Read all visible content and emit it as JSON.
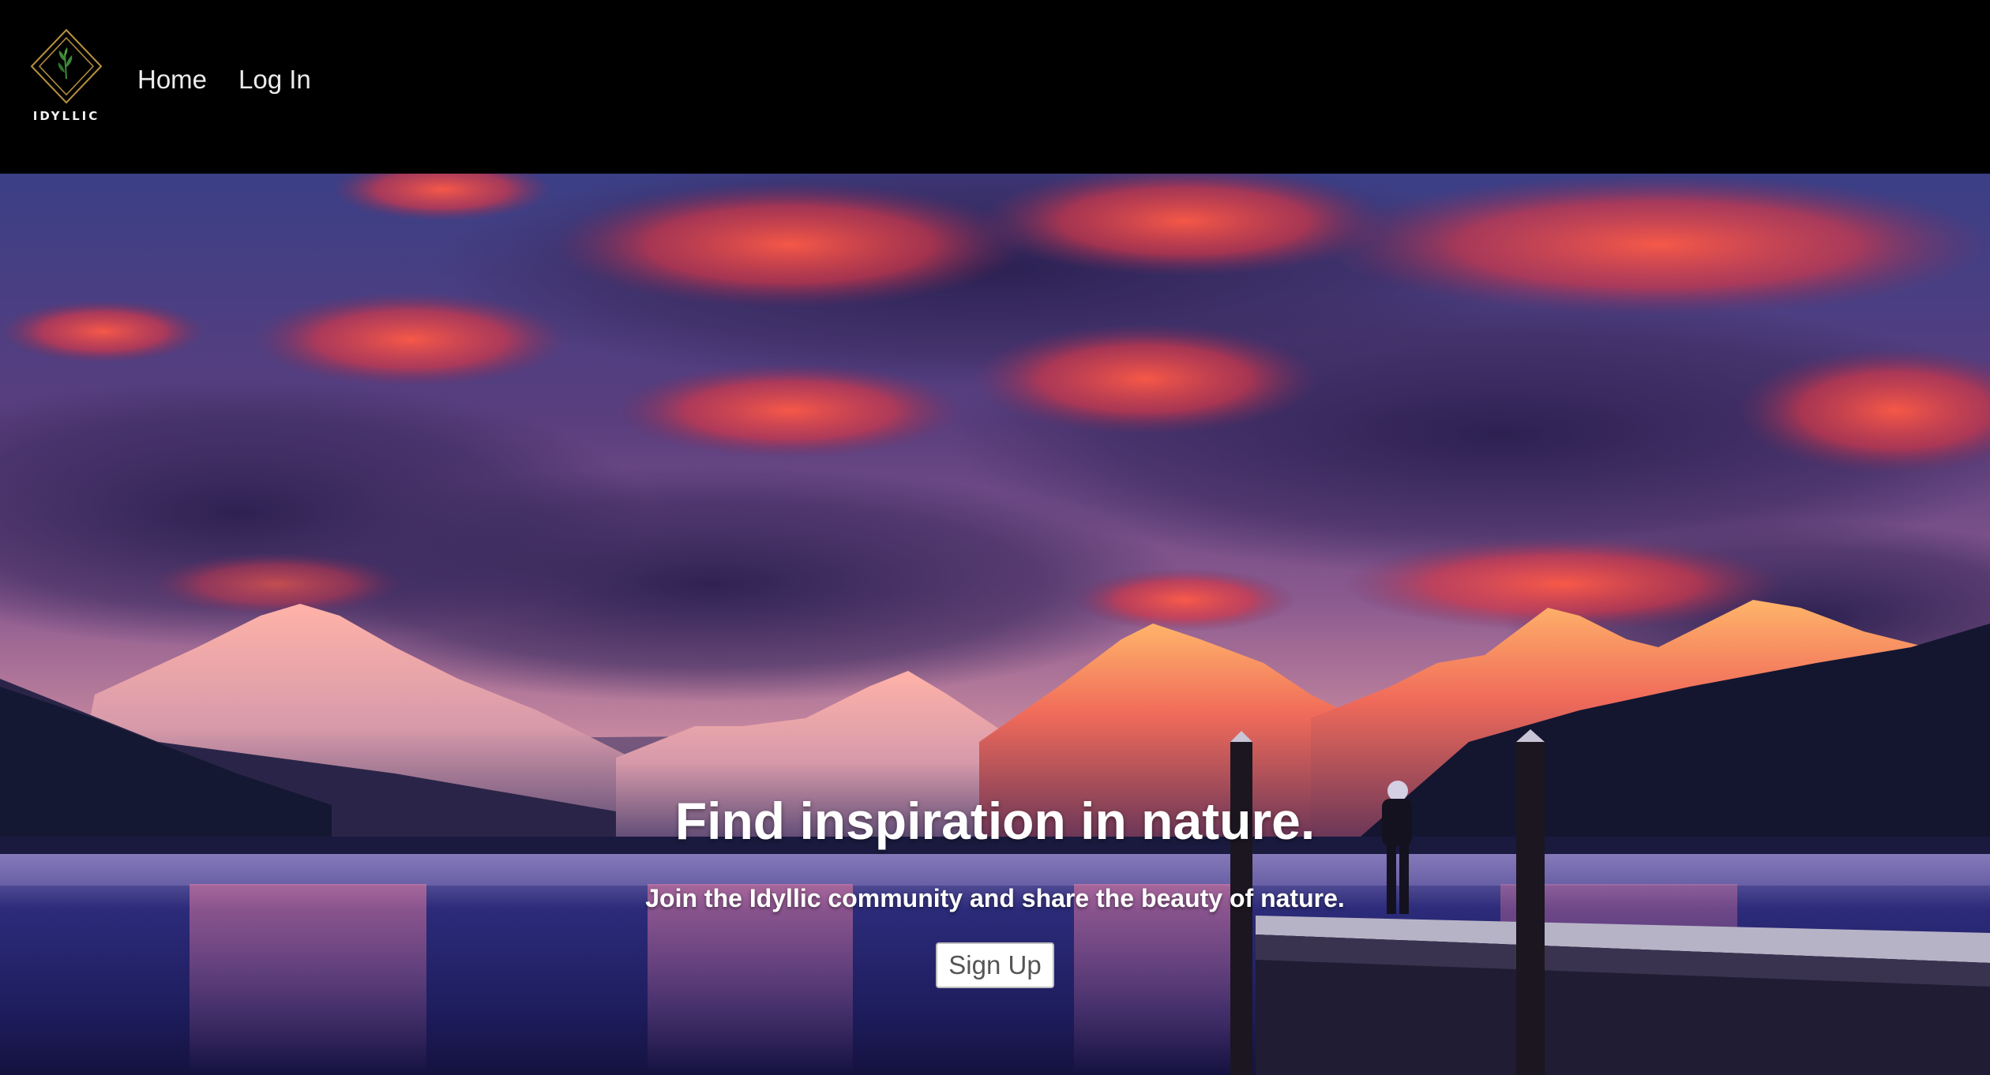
{
  "brand": {
    "logo_text": "IDYLLIC",
    "logo_icon": "diamond-leaf-icon"
  },
  "nav": {
    "items": [
      {
        "label": "Home"
      },
      {
        "label": "Log In"
      }
    ]
  },
  "hero": {
    "title": "Find inspiration in nature.",
    "subtitle": "Join the Idyllic community and share the beauty of nature.",
    "cta_label": "Sign Up",
    "background": "sunset-mountain-lake-photo"
  },
  "colors": {
    "nav_background": "#000000",
    "nav_text": "#ececec",
    "logo_gold": "#b8913f",
    "logo_leaf": "#3e8a3a",
    "hero_text": "#ffffff",
    "button_bg": "#ffffff",
    "button_text": "#555555"
  }
}
